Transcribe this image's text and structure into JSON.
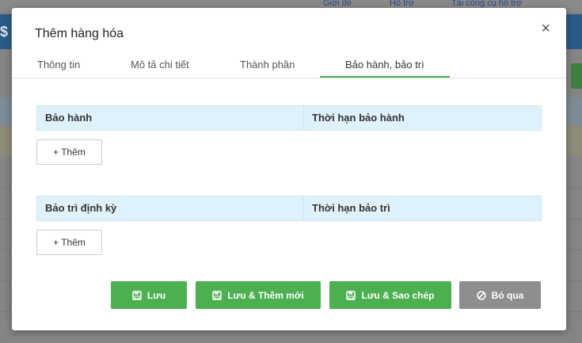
{
  "background": {
    "top_links": [
      "Giới đề",
      "Hỗ trợ",
      "Tài công cụ hỗ trợ"
    ],
    "left_symbol": "$"
  },
  "modal": {
    "title": "Thêm hàng hóa",
    "close_label": "×",
    "tabs": [
      {
        "label": "Thông tin"
      },
      {
        "label": "Mô tả chi tiết"
      },
      {
        "label": "Thành phần"
      },
      {
        "label": "Bảo hành, bảo trì"
      }
    ],
    "active_tab": 3,
    "warranty": {
      "col1": "Bảo hành",
      "col2": "Thời hạn bảo hành",
      "add_label": "+ Thêm"
    },
    "maintenance": {
      "col1": "Bảo trì định kỳ",
      "col2": "Thời hạn bảo trì",
      "add_label": "+ Thêm"
    },
    "footer": {
      "save": "Lưu",
      "save_new": "Lưu & Thêm mới",
      "save_copy": "Lưu & Sao chép",
      "skip": "Bỏ qua"
    }
  },
  "colors": {
    "accent_green": "#4caf50",
    "skip_gray": "#8e8e8e",
    "grid_header": "#dff2fb"
  }
}
